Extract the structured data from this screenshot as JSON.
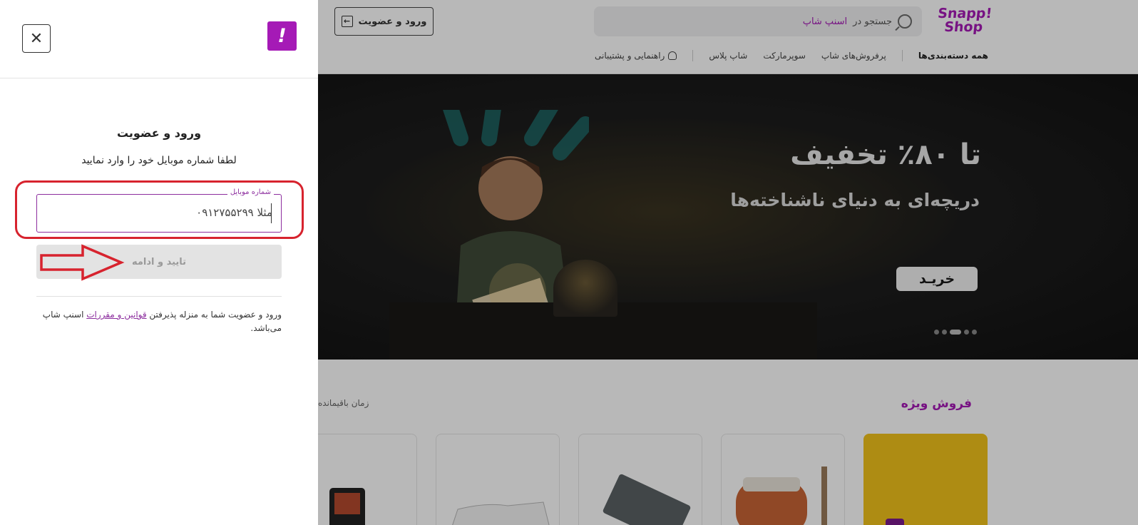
{
  "header": {
    "logo_line1": "Snapp!",
    "logo_line2": "Shop",
    "search_prefix": "جستجو در",
    "search_highlight": "اسنپ شاپ",
    "login_button": "ورود و عضویت"
  },
  "nav": {
    "all_categories": "همه دسته‌بندی‌ها",
    "items": [
      "پرفروش‌های شاپ",
      "سوپرمارکت",
      "شاپ پلاس"
    ],
    "help": "راهنمایی و پشتیبانی"
  },
  "banner": {
    "title": "تا ۸۰٪ تخفیف",
    "subtitle": "دریچه‌ای به دنیای ناشناخته‌ها",
    "cta": "خریـد",
    "slide_count": 5,
    "active_slide": 2
  },
  "flash_sale": {
    "title": "فروش ویژه",
    "time_label": "زمان باقیمانده"
  },
  "login": {
    "title": "ورود و عضویت",
    "description": "لطفا شماره موبایل خود را وارد نمایید",
    "field_label": "شماره موبایل",
    "placeholder": "مثلا ۰۹۱۲۷۵۵۲۹۹",
    "submit": "تایید و ادامه",
    "terms_prefix": "ورود و عضویت شما به منزله پذیرفتن",
    "terms_link": "قوانین و مقررات",
    "terms_suffix": "اسنپ شاپ می‌باشد."
  },
  "colors": {
    "brand": "#a51ab6",
    "annotation": "#d7232e",
    "overlay": "rgba(0,0,0,0.28)"
  }
}
